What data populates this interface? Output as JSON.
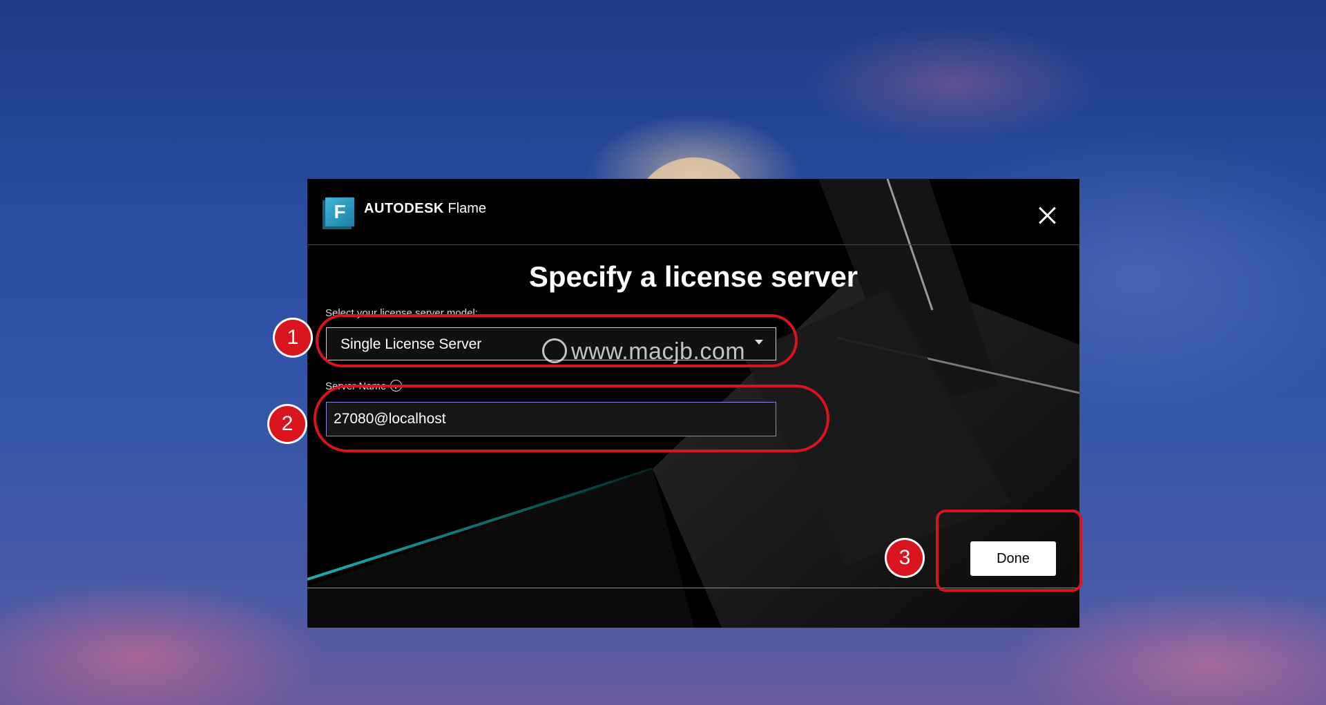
{
  "app": {
    "brand": "AUTODESK",
    "product": "Flame",
    "logo_letter": "F"
  },
  "dialog": {
    "title": "Specify a license server",
    "model_label": "Select your license server model:",
    "model_value": "Single License Server",
    "server_label": "Server Name",
    "server_value": "27080@localhost",
    "done_label": "Done"
  },
  "annotations": {
    "step1": "1",
    "step2": "2",
    "step3": "3"
  },
  "watermark": "www.macjb.com",
  "colors": {
    "accent_red": "#d9141e",
    "focus_border": "#8b85e0",
    "logo_blue": "#3fb6d6"
  }
}
